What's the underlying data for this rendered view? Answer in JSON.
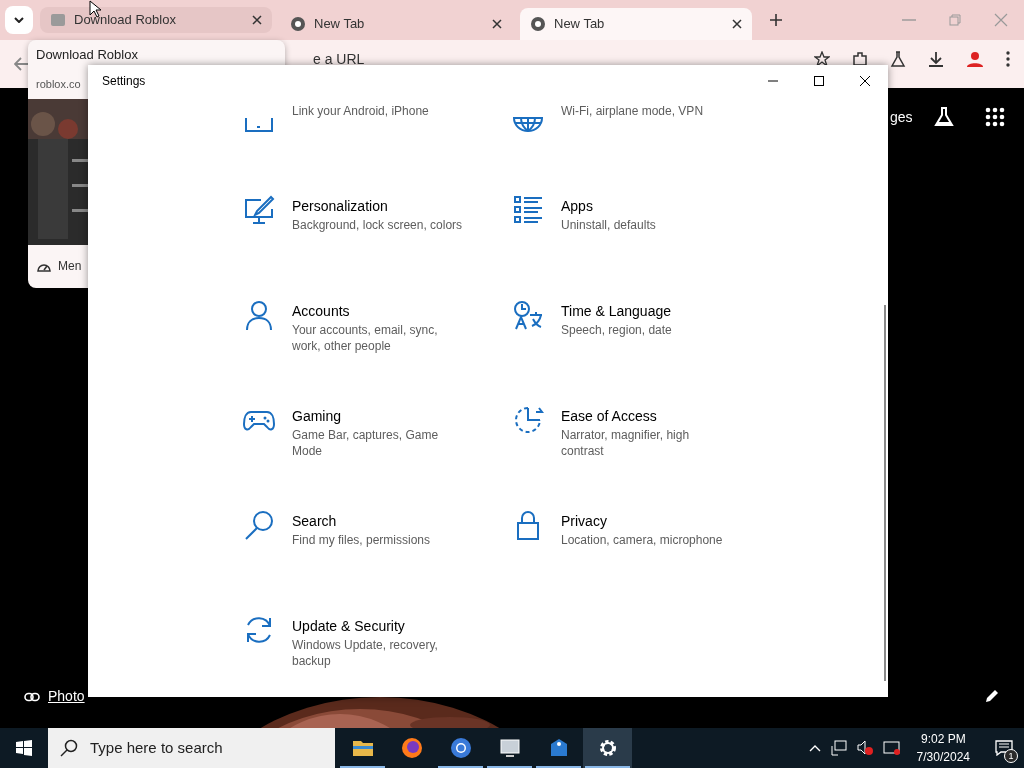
{
  "browser": {
    "tabs": [
      {
        "title": "Download Roblox",
        "selected": false,
        "hovered": true
      },
      {
        "title": "New Tab",
        "selected": false,
        "hovered": false
      },
      {
        "title": "New Tab",
        "selected": true,
        "hovered": false
      }
    ],
    "omnibox_text": "e a URL",
    "hover_card": {
      "title": "Download Roblox",
      "domain": "roblox.co",
      "footer": "Men"
    },
    "page": {
      "link_text": "ges",
      "credit": "Photo"
    }
  },
  "settings": {
    "title": "Settings",
    "items": [
      {
        "kind": "phone",
        "description": "Link your Android, iPhone"
      },
      {
        "kind": "network",
        "description": "Wi-Fi, airplane mode, VPN"
      },
      {
        "kind": "personalization",
        "title": "Personalization",
        "description": "Background, lock screen, colors"
      },
      {
        "kind": "apps",
        "title": "Apps",
        "description": "Uninstall, defaults"
      },
      {
        "kind": "accounts",
        "title": "Accounts",
        "description": "Your accounts, email, sync, work, other people"
      },
      {
        "kind": "time",
        "title": "Time & Language",
        "description": "Speech, region, date"
      },
      {
        "kind": "gaming",
        "title": "Gaming",
        "description": "Game Bar, captures, Game Mode"
      },
      {
        "kind": "ease",
        "title": "Ease of Access",
        "description": "Narrator, magnifier, high contrast"
      },
      {
        "kind": "search",
        "title": "Search",
        "description": "Find my files, permissions"
      },
      {
        "kind": "privacy",
        "title": "Privacy",
        "description": "Location, camera, microphone"
      },
      {
        "kind": "update",
        "title": "Update & Security",
        "description": "Windows Update, recovery, backup"
      }
    ]
  },
  "taskbar": {
    "search_placeholder": "Type here to search",
    "apps": [
      {
        "kind": "folder",
        "active": false,
        "open": true
      },
      {
        "kind": "firefox",
        "active": false,
        "open": false
      },
      {
        "kind": "chrome",
        "active": false,
        "open": true
      },
      {
        "kind": "monitor",
        "active": false,
        "open": true
      },
      {
        "kind": "network",
        "active": false,
        "open": true
      },
      {
        "kind": "gear",
        "active": true,
        "open": true
      }
    ],
    "time": "9:02 PM",
    "date": "7/30/2024",
    "notifications": "1"
  }
}
